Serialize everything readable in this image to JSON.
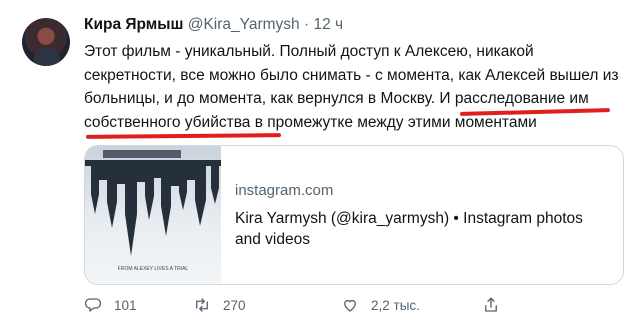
{
  "tweet": {
    "author_name": "Кира Ярмыш",
    "handle": "@Kira_Yarmysh",
    "separator": "·",
    "time": "12 ч",
    "text_part1": "Этот фильм - уникальный. Полный доступ к Алексею, никакой секретности, все можно было снимать - с момента, как Алексей вышел из больницы, и до момента, как вернулся в Москву. ",
    "text_highlight": "И расследование им собственного убийства",
    "text_part2": " в промежутке между этими моментами",
    "highlight_color": "#e01e1e"
  },
  "card": {
    "thumb_caption": "FROM ALEXEY LIVES A TRIAL",
    "domain": "instagram.com",
    "title": "Kira Yarmysh (@kira_yarmysh) • Instagram photos and videos"
  },
  "actions": {
    "reply_count": "101",
    "retweet_count": "270",
    "like_count": "2,2 тыс.",
    "icons": [
      "reply-icon",
      "retweet-icon",
      "like-icon",
      "share-icon"
    ]
  }
}
